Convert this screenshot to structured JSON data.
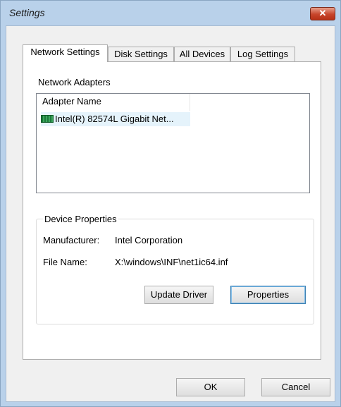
{
  "window": {
    "title": "Settings"
  },
  "tabs": [
    {
      "label": "Network Settings",
      "active": true
    },
    {
      "label": "Disk Settings",
      "active": false
    },
    {
      "label": "All Devices",
      "active": false
    },
    {
      "label": "Log Settings",
      "active": false
    }
  ],
  "network_adapters": {
    "section_label": "Network Adapters",
    "column_header": "Adapter Name",
    "items": [
      {
        "name": "Intel(R) 82574L Gigabit Net...",
        "icon": "network-card-icon"
      }
    ]
  },
  "device_properties": {
    "legend": "Device Properties",
    "manufacturer_label": "Manufacturer:",
    "manufacturer_value": "Intel Corporation",
    "file_name_label": "File Name:",
    "file_name_value": "X:\\windows\\INF\\net1ic64.inf",
    "update_driver_label": "Update Driver",
    "properties_label": "Properties"
  },
  "dialog_buttons": {
    "ok_label": "OK",
    "cancel_label": "Cancel"
  },
  "colors": {
    "title_bar": "#b9d1ea",
    "close_button": "#c7452b",
    "selection": "#e5f3fb",
    "focus_border": "#3c7fb1"
  }
}
